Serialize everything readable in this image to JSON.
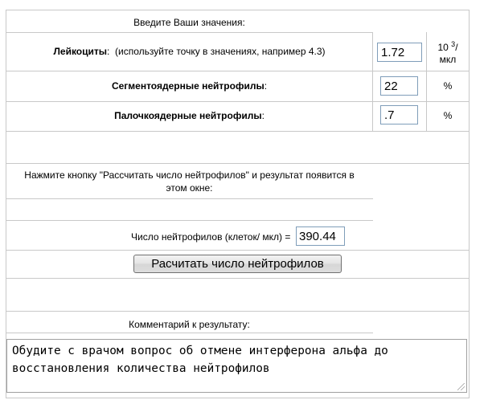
{
  "form": {
    "header": "Введите Ваши значения:",
    "leukocytes": {
      "label_bold": "Лейкоциты",
      "label_note": ":  (используйте точку в значениях, например 4.3)",
      "value": "1.72",
      "unit_base": "10",
      "unit_exp": "3",
      "unit_slash": "/",
      "unit_line2": "мкл"
    },
    "segmented": {
      "label_bold": "Сегментоядерные нейтрофилы",
      "label_tail": ":",
      "value": "22",
      "unit": "%"
    },
    "band": {
      "label_bold": "Палочкоядерные нейтрофилы",
      "label_tail": ":",
      "value": ".7",
      "unit": "%"
    },
    "instruction_line1": "Нажмите кнопку \"Рассчитать число нейтрофилов\" и результат появится в",
    "instruction_line2": "этом окне:",
    "result_label": "Число нейтрофилов (клеток/ мкл) =",
    "result_value": "390.44",
    "calculate_button": "Расчитать число нейтрофилов",
    "comment_label": "Комментарий к результату:",
    "comment_text": "Обудите с врачом вопрос об отмене интерферона альфа до восстановления количества нейтрофилов"
  }
}
